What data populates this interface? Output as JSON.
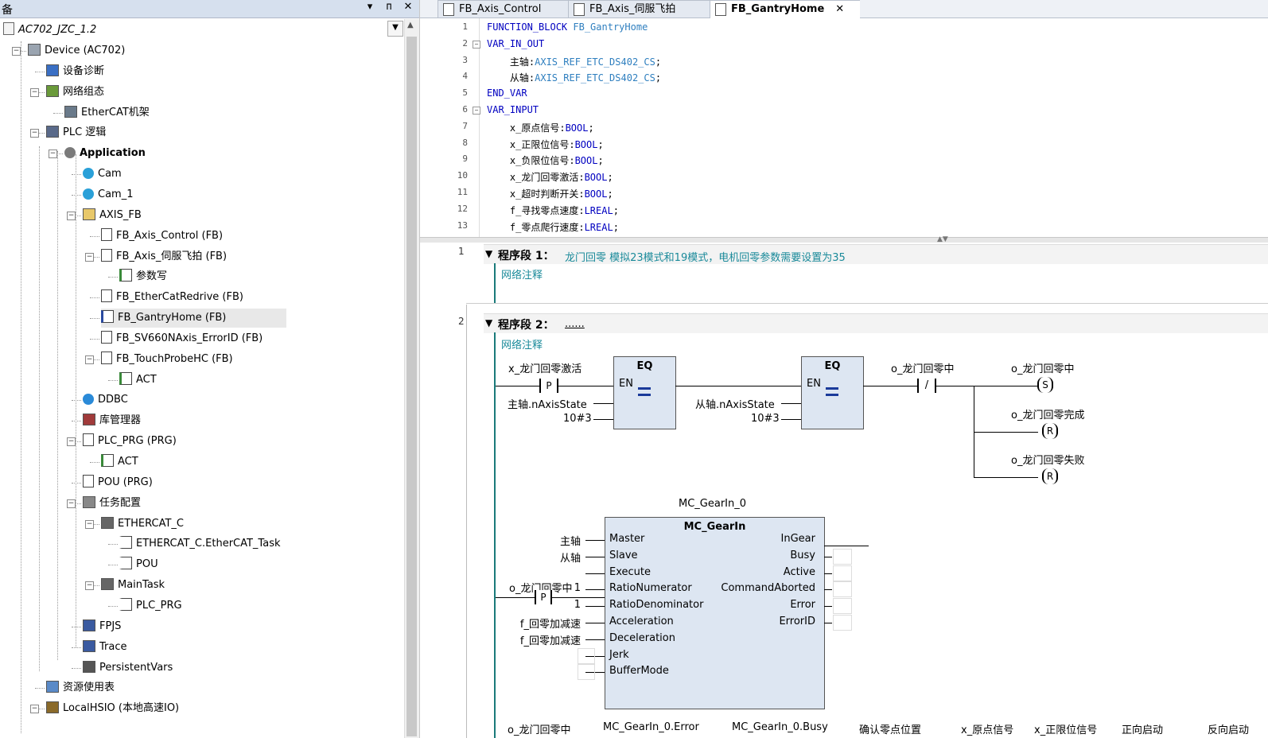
{
  "left_panel": {
    "title": "备",
    "controls": {
      "dropdown": "▾",
      "pin": "ᴨ",
      "close": "✕"
    },
    "root": "AC702_JZC_1.2",
    "tree": [
      {
        "label": "Device (AC702)",
        "icon": "device-icon",
        "level": 1,
        "expander": "−"
      },
      {
        "label": "设备诊断",
        "icon": "diagnostics-icon",
        "level": 2,
        "expander": ""
      },
      {
        "label": "网络组态",
        "icon": "network-icon",
        "level": 2,
        "expander": "−"
      },
      {
        "label": "EtherCAT机架",
        "icon": "ethercat-rack-icon",
        "level": 3,
        "expander": ""
      },
      {
        "label": "PLC 逻辑",
        "icon": "plc-logic-icon",
        "level": 2,
        "expander": "−"
      },
      {
        "label": "Application",
        "icon": "application-gear-icon",
        "level": 3,
        "expander": "−",
        "bold": true
      },
      {
        "label": "Cam",
        "icon": "cam-icon",
        "level": 4,
        "expander": ""
      },
      {
        "label": "Cam_1",
        "icon": "cam-icon",
        "level": 4,
        "expander": ""
      },
      {
        "label": "AXIS_FB",
        "icon": "folder-icon",
        "level": 4,
        "expander": "−"
      },
      {
        "label": "FB_Axis_Control (FB)",
        "icon": "document-icon",
        "level": 5,
        "expander": ""
      },
      {
        "label": "FB_Axis_伺服飞拍 (FB)",
        "icon": "document-icon",
        "level": 5,
        "expander": "−"
      },
      {
        "label": "参数写",
        "icon": "action-icon",
        "level": 6,
        "expander": ""
      },
      {
        "label": "FB_EtherCatRedrive (FB)",
        "icon": "document-icon",
        "level": 5,
        "expander": ""
      },
      {
        "label": "FB_GantryHome (FB)",
        "icon": "ladder-document-icon",
        "level": 5,
        "expander": "",
        "selected": true
      },
      {
        "label": "FB_SV660NAxis_ErrorID (FB)",
        "icon": "document-icon",
        "level": 5,
        "expander": ""
      },
      {
        "label": "FB_TouchProbeHC (FB)",
        "icon": "document-icon",
        "level": 5,
        "expander": "−"
      },
      {
        "label": "ACT",
        "icon": "action-icon",
        "level": 6,
        "expander": ""
      },
      {
        "label": "DDBC",
        "icon": "globe-icon",
        "level": 4,
        "expander": ""
      },
      {
        "label": "库管理器",
        "icon": "library-icon",
        "level": 4,
        "expander": ""
      },
      {
        "label": "PLC_PRG (PRG)",
        "icon": "document-icon",
        "level": 4,
        "expander": "−"
      },
      {
        "label": "ACT",
        "icon": "action-icon",
        "level": 5,
        "expander": ""
      },
      {
        "label": "POU (PRG)",
        "icon": "document-icon",
        "level": 4,
        "expander": ""
      },
      {
        "label": "任务配置",
        "icon": "task-config-icon",
        "level": 4,
        "expander": "−"
      },
      {
        "label": "ETHERCAT_C",
        "icon": "task-icon",
        "level": 5,
        "expander": "−"
      },
      {
        "label": "ETHERCAT_C.EtherCAT_Task",
        "icon": "task-call-icon",
        "level": 6,
        "expander": ""
      },
      {
        "label": "POU",
        "icon": "task-call-icon",
        "level": 6,
        "expander": ""
      },
      {
        "label": "MainTask",
        "icon": "task-icon",
        "level": 5,
        "expander": "−"
      },
      {
        "label": "PLC_PRG",
        "icon": "task-call-icon",
        "level": 6,
        "expander": ""
      },
      {
        "label": "FPJS",
        "icon": "trace-icon",
        "level": 4,
        "expander": ""
      },
      {
        "label": "Trace",
        "icon": "trace-icon",
        "level": 4,
        "expander": ""
      },
      {
        "label": "PersistentVars",
        "icon": "persistent-icon",
        "level": 4,
        "expander": ""
      },
      {
        "label": "资源使用表",
        "icon": "table-icon",
        "level": 2,
        "expander": ""
      },
      {
        "label": "LocalHSIO (本地高速IO)",
        "icon": "hsio-icon",
        "level": 2,
        "expander": "−"
      }
    ]
  },
  "tabs": [
    {
      "label": "FB_Axis_Control"
    },
    {
      "label": "FB_Axis_伺服飞拍"
    },
    {
      "label": "FB_GantryHome",
      "active": true,
      "close": "✕"
    }
  ],
  "code_lines": [
    {
      "n": "1",
      "segs": [
        [
          "kw",
          "FUNCTION_BLOCK "
        ],
        [
          "ty",
          "FB_GantryHome"
        ]
      ]
    },
    {
      "n": "2",
      "segs": [
        [
          "kw",
          "VAR_IN_OUT"
        ]
      ],
      "fold": "−"
    },
    {
      "n": "3",
      "segs": [
        [
          "",
          "    主轴:"
        ],
        [
          "ty",
          "AXIS_REF_ETC_DS402_CS"
        ],
        [
          "",
          ";"
        ]
      ]
    },
    {
      "n": "4",
      "segs": [
        [
          "",
          "    从轴:"
        ],
        [
          "ty",
          "AXIS_REF_ETC_DS402_CS"
        ],
        [
          "",
          ";"
        ]
      ]
    },
    {
      "n": "5",
      "segs": [
        [
          "kw",
          "END_VAR"
        ]
      ]
    },
    {
      "n": "6",
      "segs": [
        [
          "kw",
          "VAR_INPUT"
        ]
      ],
      "fold": "−"
    },
    {
      "n": "7",
      "segs": [
        [
          "",
          "    x_原点信号:"
        ],
        [
          "kw",
          "BOOL"
        ],
        [
          "",
          ";"
        ]
      ]
    },
    {
      "n": "8",
      "segs": [
        [
          "",
          "    x_正限位信号:"
        ],
        [
          "kw",
          "BOOL"
        ],
        [
          "",
          ";"
        ]
      ]
    },
    {
      "n": "9",
      "segs": [
        [
          "",
          "    x_负限位信号:"
        ],
        [
          "kw",
          "BOOL"
        ],
        [
          "",
          ";"
        ]
      ]
    },
    {
      "n": "10",
      "segs": [
        [
          "",
          "    x_龙门回零激活:"
        ],
        [
          "kw",
          "BOOL"
        ],
        [
          "",
          ";"
        ]
      ]
    },
    {
      "n": "11",
      "segs": [
        [
          "",
          "    x_超时判断开关:"
        ],
        [
          "kw",
          "BOOL"
        ],
        [
          "",
          ";"
        ]
      ]
    },
    {
      "n": "12",
      "segs": [
        [
          "",
          "    f_寻找零点速度:"
        ],
        [
          "kw",
          "LREAL"
        ],
        [
          "",
          ";"
        ]
      ]
    },
    {
      "n": "13",
      "segs": [
        [
          "",
          "    f_零点爬行速度:"
        ],
        [
          "kw",
          "LREAL"
        ],
        [
          "",
          ";"
        ]
      ]
    }
  ],
  "networks": {
    "n1": {
      "num": "1",
      "label": "程序段 1：",
      "comment": "龙门回零 模拟23模式和19模式，电机回零参数需要设置为35",
      "net_comment": "网络注释"
    },
    "n2": {
      "num": "2",
      "label": "程序段 2：",
      "comment": "......",
      "net_comment": "网络注释"
    }
  },
  "ladder": {
    "contact1_var": "x_龙门回零激活",
    "contact1_sym": "P",
    "eq1": {
      "name": "EQ",
      "en": "EN",
      "in1": "主轴.nAxisState",
      "in2": "10#3"
    },
    "eq2": {
      "name": "EQ",
      "en": "EN",
      "in1": "从轴.nAxisState",
      "in2": "10#3"
    },
    "contact2_var": "o_龙门回零中",
    "contact2_sym": "/",
    "coil1": {
      "var": "o_龙门回零中",
      "sym": "S"
    },
    "coil2": {
      "var": "o_龙门回零完成",
      "sym": "R"
    },
    "coil3": {
      "var": "o_龙门回零失败",
      "sym": "R"
    },
    "gear": {
      "instance": "MC_GearIn_0",
      "type": "MC_GearIn",
      "inputs": [
        "Master",
        "Slave",
        "Execute",
        "RatioNumerator",
        "RatioDenominator",
        "Acceleration",
        "Deceleration",
        "Jerk",
        "BufferMode"
      ],
      "outputs": [
        "InGear",
        "Busy",
        "Active",
        "CommandAborted",
        "Error",
        "ErrorID"
      ],
      "input_vars": [
        "主轴",
        "从轴",
        "",
        "1",
        "1",
        "f_回零加减速",
        "f_回零加减速"
      ],
      "exec_contact_var": "o_龙门回零中",
      "exec_contact_sym": "P"
    },
    "bottom_labels": [
      "o_龙门回零中",
      "MC_GearIn_0.Error",
      "MC_GearIn_0.Busy",
      "确认零点位置",
      "x_原点信号",
      "x_正限位信号",
      "正向启动",
      "反向启动"
    ]
  }
}
